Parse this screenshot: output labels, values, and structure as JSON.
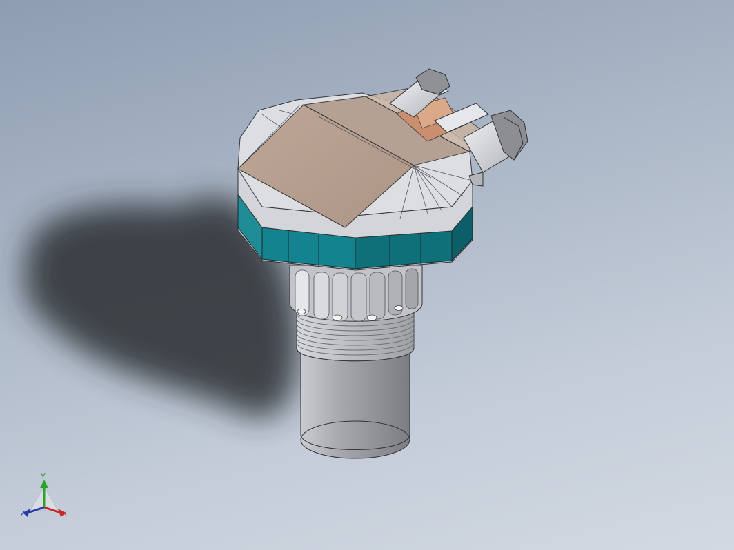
{
  "viewport": {
    "name": "model-viewport"
  },
  "model": {
    "name": "level-sensor-3d-model",
    "colors": {
      "housing": "#c9ccd2",
      "lid": "#b8a191",
      "band": "#16818c",
      "body": "#9a9ca3",
      "shadow": "#2b2e33"
    }
  },
  "triad": {
    "x_label": "X",
    "y_label": "Y",
    "z_label": "Z"
  }
}
